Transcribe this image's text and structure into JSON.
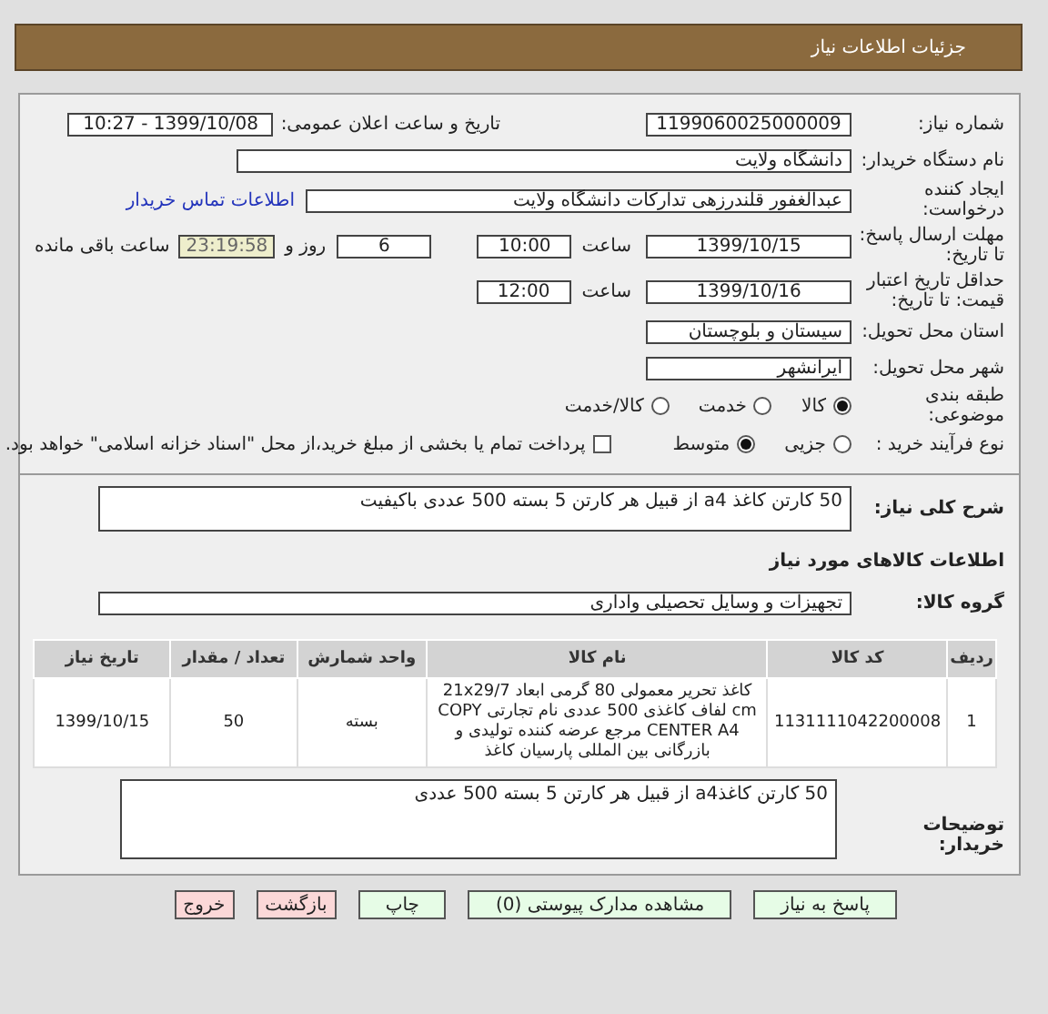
{
  "header": {
    "title": "جزئیات اطلاعات نیاز"
  },
  "need_number": {
    "label": "شماره نیاز:",
    "value": "1199060025000009"
  },
  "announce": {
    "label": "تاریخ و ساعت اعلان عمومی:",
    "value": "1399/10/08 - 10:27"
  },
  "buyer_org": {
    "label": "نام دستگاه خریدار:",
    "value": "دانشگاه ولایت"
  },
  "requester": {
    "label": "ایجاد کننده درخواست:",
    "value": "عبدالغفور قلندرزهی تدارکات دانشگاه ولایت",
    "link": "اطلاعات تماس خریدار"
  },
  "response_deadline": {
    "label": "مهلت ارسال پاسخ: تا تاریخ:",
    "date": "1399/10/15",
    "time_label": "ساعت",
    "time": "10:00",
    "days": "6",
    "days_label": "روز و",
    "remaining": "23:19:58",
    "remaining_label": "ساعت باقی مانده"
  },
  "price_validity": {
    "label": "حداقل تاریخ اعتبار قیمت: تا تاریخ:",
    "date": "1399/10/16",
    "time_label": "ساعت",
    "time": "12:00"
  },
  "delivery_province": {
    "label": "استان محل تحویل:",
    "value": "سیستان و بلوچستان"
  },
  "delivery_city": {
    "label": "شهر محل تحویل:",
    "value": "ایرانشهر"
  },
  "category": {
    "label": "طبقه بندی موضوعی:",
    "options": [
      {
        "label": "کالا",
        "selected": true
      },
      {
        "label": "خدمت",
        "selected": false
      },
      {
        "label": "کالا/خدمت",
        "selected": false
      }
    ]
  },
  "process": {
    "label": "نوع فرآیند خرید :",
    "options": [
      {
        "label": "جزیی",
        "selected": false
      },
      {
        "label": "متوسط",
        "selected": true
      }
    ],
    "treasury": {
      "label": "پرداخت تمام یا بخشی از مبلغ خرید،از محل \"اسناد خزانه اسلامی\" خواهد بود.",
      "checked": false
    }
  },
  "summary": {
    "label": "شرح کلی نیاز:",
    "value": "50 کارتن کاغذ a4 از قبیل هر کارتن 5 بسته 500 عددی باکیفیت"
  },
  "goods_heading": "اطلاعات کالاهای مورد نیاز",
  "goods_group": {
    "label": "گروه کالا:",
    "value": "تجهیزات و وسایل تحصیلی واداری"
  },
  "table": {
    "columns": [
      "ردیف",
      "کد کالا",
      "نام کالا",
      "واحد شمارش",
      "تعداد / مقدار",
      "تاریخ نیاز"
    ],
    "rows": [
      [
        "1",
        "1131111042200008",
        "کاغذ تحریر معمولی 80 گرمی ابعاد 21x29/7 cm لفاف کاغذی 500 عددی نام تجارتی COPY CENTER A4 مرجع عرضه کننده تولیدی و بازرگانی بین المللی پارسیان کاغذ",
        "بسته",
        "50",
        "1399/10/15"
      ]
    ]
  },
  "buyer_notes": {
    "label": "توضیحات خریدار:",
    "value": "50 کارتن کاغذa4 از قبیل هر کارتن 5 بسته 500 عددی"
  },
  "buttons": [
    {
      "label": "پاسخ به نیاز",
      "kind": "normal"
    },
    {
      "label": "مشاهده مدارک پیوستی (0)",
      "kind": "normal"
    },
    {
      "label": "چاپ",
      "kind": "normal"
    },
    {
      "label": "بازگشت",
      "kind": "exit"
    },
    {
      "label": "خروج",
      "kind": "exit"
    }
  ]
}
